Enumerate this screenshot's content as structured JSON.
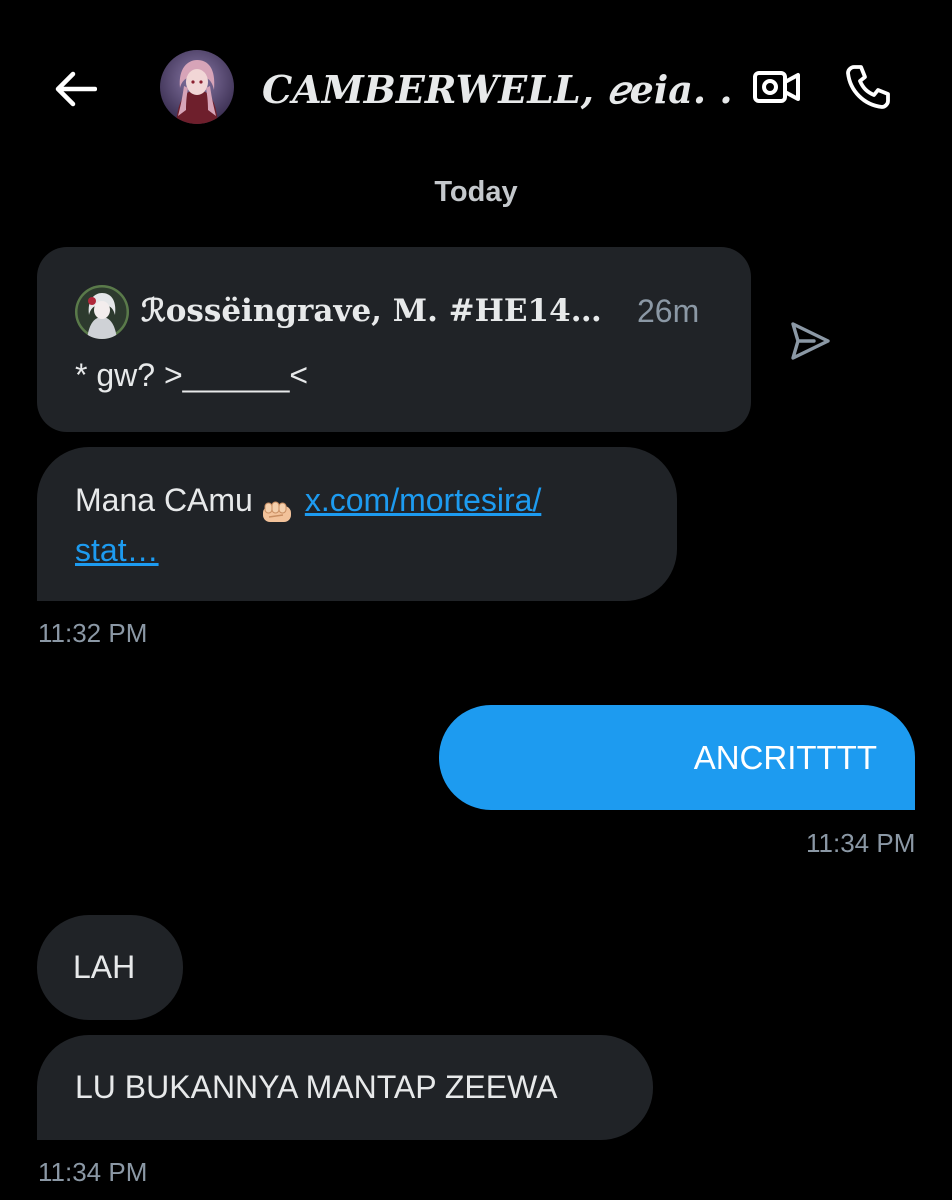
{
  "header": {
    "title": "CAMBERWELL, ℯeia. …",
    "back_icon": "arrow-left-icon",
    "video_icon": "video-camera-icon",
    "phone_icon": "phone-icon"
  },
  "date_separator": "Today",
  "quoted_post": {
    "author": "ℛossëingrave, M. #HE14…",
    "time_ago": "26m",
    "text": "* gw? >______<",
    "share_icon": "send-icon"
  },
  "messages": [
    {
      "direction": "incoming",
      "text_prefix": "Mana CAmu",
      "emoji": "oncoming-fist",
      "link_line1": "x.com/mortesira/",
      "link_line2": "stat…",
      "timestamp": "11:32 PM"
    },
    {
      "direction": "outgoing",
      "text": "ANCRITTTT",
      "timestamp": "11:34 PM"
    },
    {
      "direction": "incoming",
      "text": "LAH"
    },
    {
      "direction": "incoming",
      "text": "LU BUKANNYA MANTAP ZEEWA",
      "timestamp": "11:34 PM"
    }
  ],
  "colors": {
    "background": "#000000",
    "incoming_bubble": "#202327",
    "outgoing_bubble": "#1d9bf0",
    "link": "#1d9bf0",
    "muted_text": "#8b98a5"
  }
}
